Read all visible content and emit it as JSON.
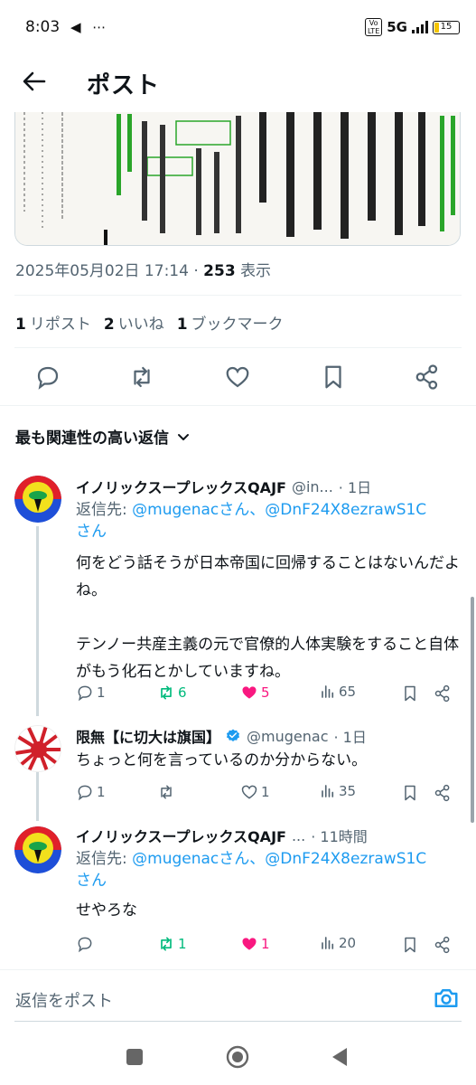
{
  "status_bar": {
    "time": "8:03",
    "left_icons": "◀ ⋯",
    "network": "5G",
    "volte_top": "Vo",
    "volte_bottom": "LTE",
    "battery": "15"
  },
  "header": {
    "title": "ポスト"
  },
  "tweet": {
    "date": "2025年05月02日 17:14",
    "separator": " · ",
    "views_count": "253",
    "views_label": "表示",
    "stats": {
      "reposts_count": "1",
      "reposts_label": "リポスト",
      "likes_count": "2",
      "likes_label": "いいね",
      "bookmarks_count": "1",
      "bookmarks_label": "ブックマーク"
    }
  },
  "replies_section": {
    "title": "最も関連性の高い返信"
  },
  "replies": [
    {
      "name": "イノリックスープレックスQAJF",
      "handle": "@in...",
      "time": "· 1日",
      "reply_to_prefix": "返信先: ",
      "reply_to_links": "@mugenacさん、@DnF24X8ezrawS1C",
      "reply_to_suffix": "さん",
      "text": "何をどう話そうが日本帝国に回帰することはないんだよね。\n\nテンノー共産主義の元で官僚的人体実験をすること自体がもう化石とかしていますね。",
      "replies": "1",
      "reposts": "6",
      "likes": "5",
      "views": "65"
    },
    {
      "name": "限無【に切大は旗国】",
      "handle": "@mugenac",
      "time": "· 1日",
      "text": "ちょっと何を言っているのか分からない。",
      "replies": "1",
      "reposts": "",
      "likes": "1",
      "views": "35"
    },
    {
      "name": "イノリックスープレックスQAJF",
      "handle": "...",
      "time": "· 11時間",
      "reply_to_prefix": "返信先: ",
      "reply_to_links": "@mugenacさん、@DnF24X8ezrawS1C",
      "reply_to_suffix": "さん",
      "text": "せやろな",
      "replies": "",
      "reposts": "1",
      "likes": "1",
      "views": "20"
    }
  ],
  "composer": {
    "placeholder": "返信をポスト"
  },
  "colors": {
    "accent": "#1d9bf0",
    "repost_green": "#00ba7c",
    "like_pink": "#f91880",
    "muted": "#536471"
  }
}
